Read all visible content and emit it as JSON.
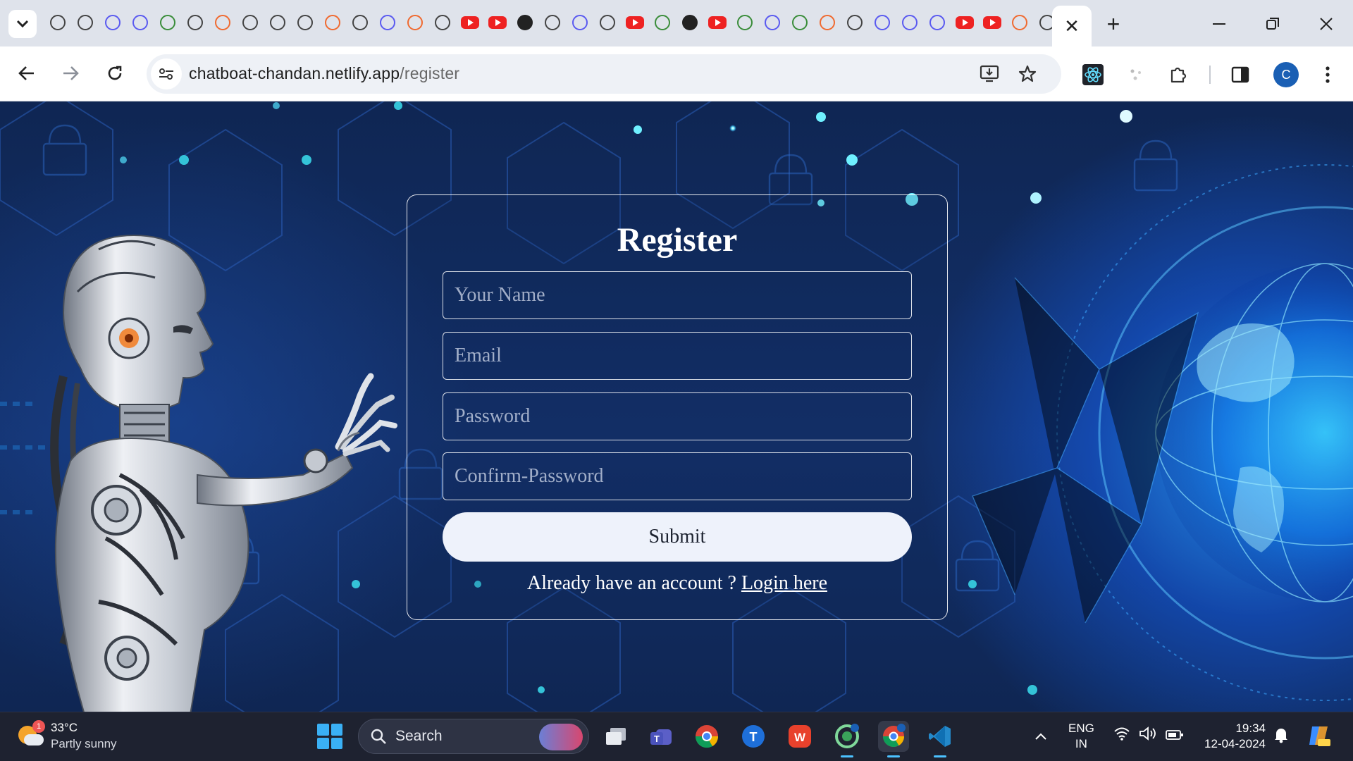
{
  "browser": {
    "active_tab_close": "✕",
    "new_tab": "+",
    "address": {
      "host": "chatboat-chandan.netlify.app",
      "path": "/register"
    },
    "profile_initial": "C"
  },
  "register_form": {
    "title": "Register",
    "fields": {
      "name_placeholder": "Your Name",
      "email_placeholder": "Email",
      "password_placeholder": "Password",
      "confirm_placeholder": "Confirm-Password"
    },
    "submit_label": "Submit",
    "login_prompt": "Already have an account ?",
    "login_link": "Login here"
  },
  "taskbar": {
    "weather_badge": "1",
    "weather_temp": "33°C",
    "weather_condition": "Partly sunny",
    "search_label": "Search",
    "lang_line1": "ENG",
    "lang_line2": "IN",
    "time": "19:34",
    "date": "12-04-2024"
  },
  "colors": {
    "page_background": "#0f2653",
    "accent_glow": "#28a0ff",
    "submit_bg": "#eef2fb",
    "taskbar_bg": "#1e2230"
  }
}
